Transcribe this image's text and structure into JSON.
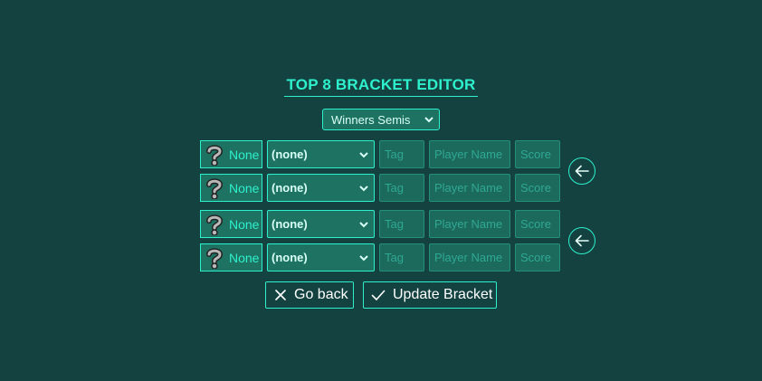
{
  "editor": {
    "title": "TOP 8 BRACKET EDITOR",
    "round_select_value": "Winners Semis"
  },
  "match_rows": [
    {
      "character_label": "None",
      "player_select_value": "(none)",
      "tag_placeholder": "Tag",
      "player_name_placeholder": "Player Name",
      "score_placeholder": "Score"
    },
    {
      "character_label": "None",
      "player_select_value": "(none)",
      "tag_placeholder": "Tag",
      "player_name_placeholder": "Player Name",
      "score_placeholder": "Score"
    },
    {
      "character_label": "None",
      "player_select_value": "(none)",
      "tag_placeholder": "Tag",
      "player_name_placeholder": "Player Name",
      "score_placeholder": "Score"
    },
    {
      "character_label": "None",
      "player_select_value": "(none)",
      "tag_placeholder": "Tag",
      "player_name_placeholder": "Player Name",
      "score_placeholder": "Score"
    }
  ],
  "icons": {
    "character": "question-mark-icon",
    "advance": "arrow-left-icon",
    "dropdown": "chevron-down-icon",
    "go_back": "close-icon",
    "update": "check-icon"
  },
  "actions": {
    "go_back_label": "Go back",
    "update_label": "Update Bracket"
  },
  "colors": {
    "background": "#134241",
    "accent": "#2ef0cc",
    "field_fill": "#1e7262",
    "placeholder": "#2fa893"
  }
}
